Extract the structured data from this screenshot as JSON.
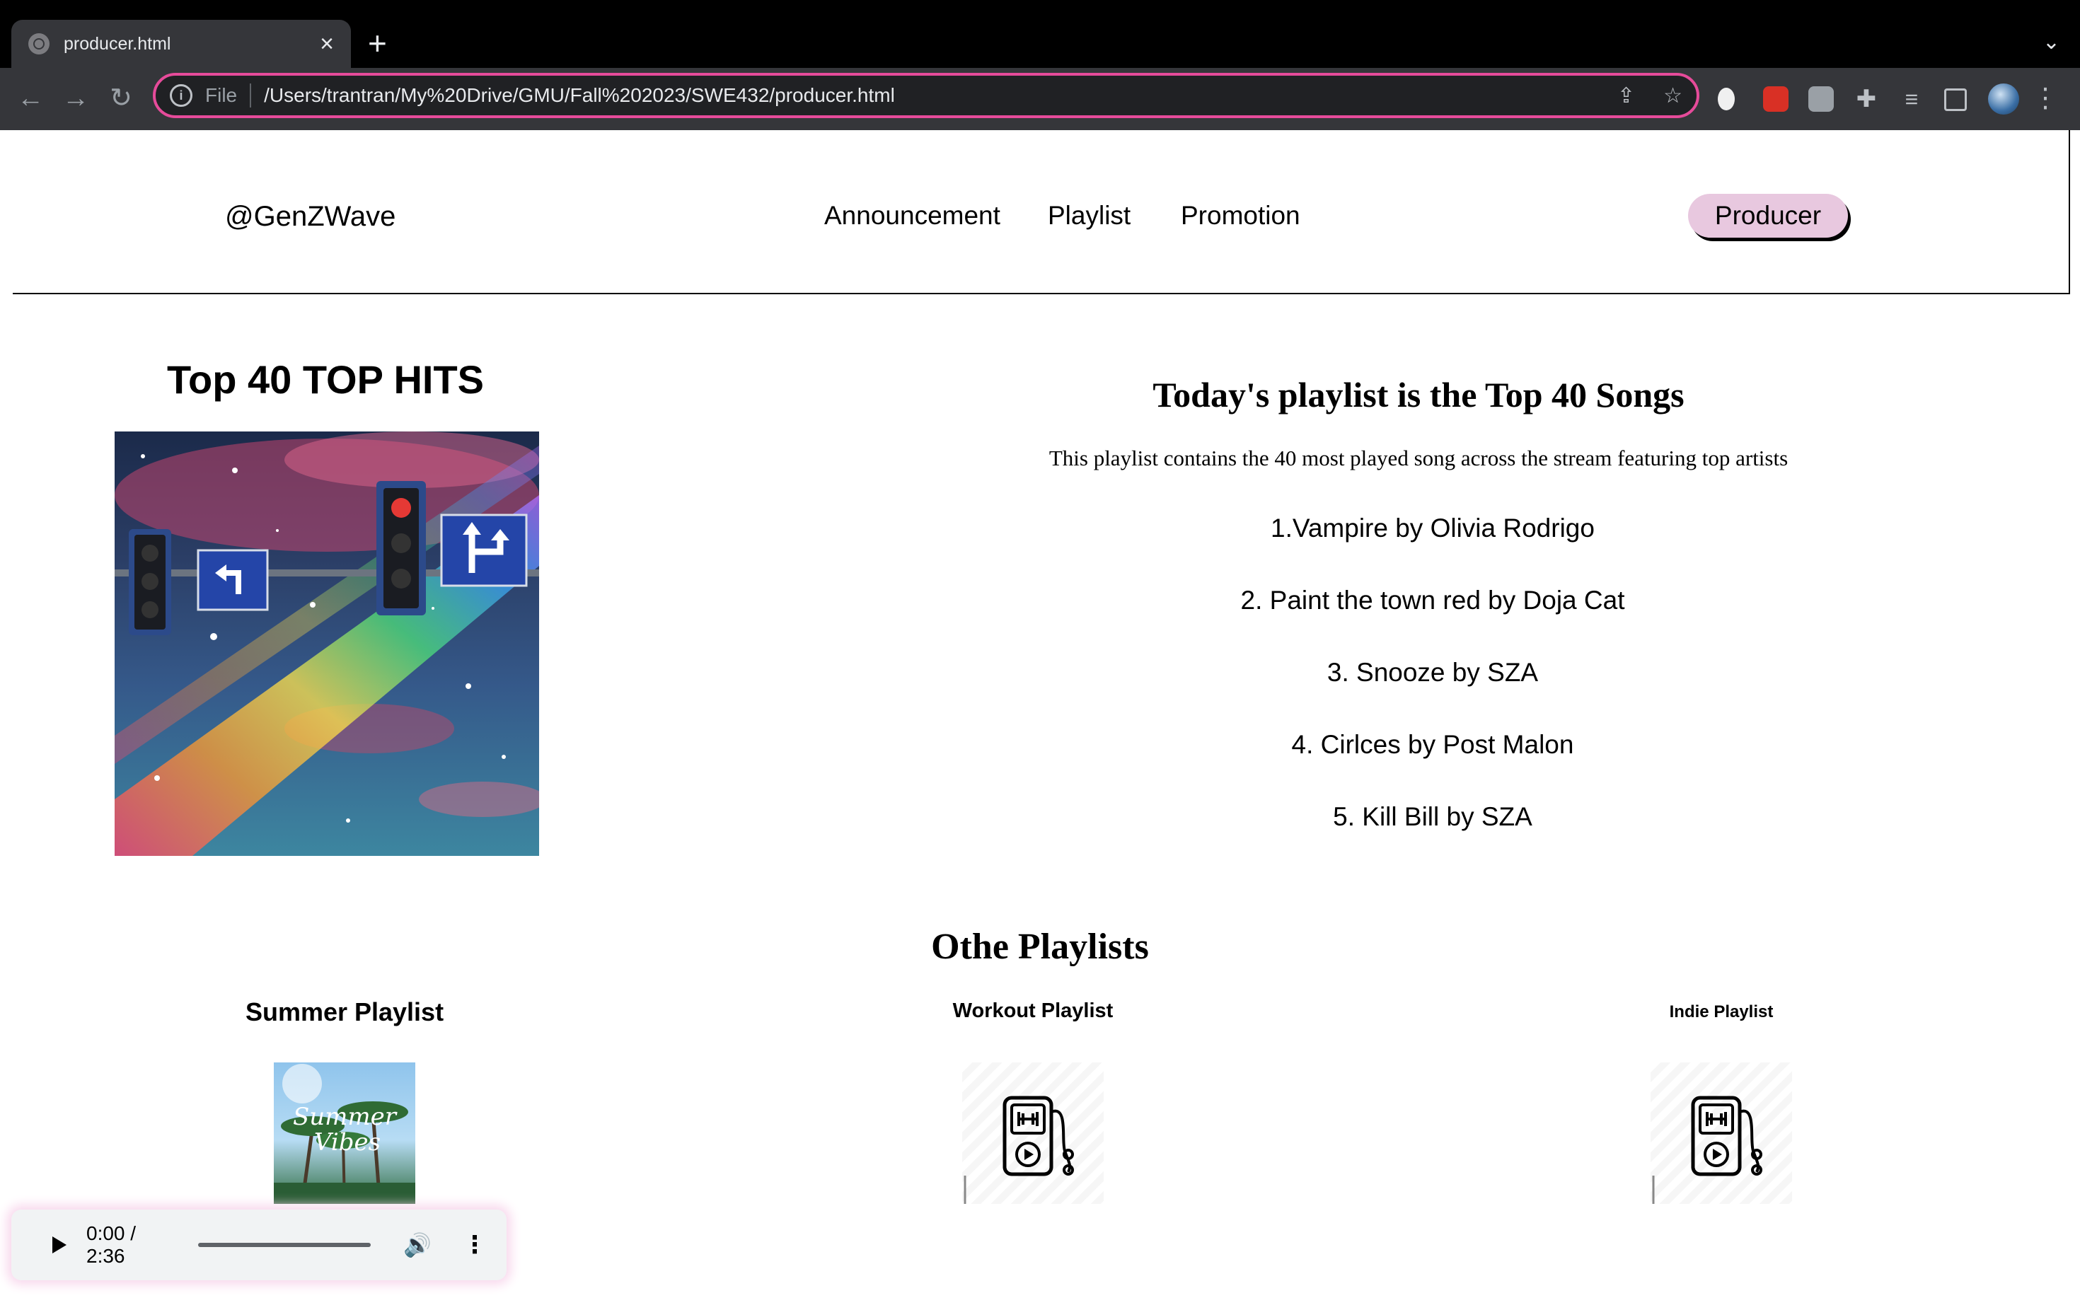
{
  "browser": {
    "tab_title": "producer.html",
    "new_tab": "+",
    "close": "×",
    "scheme_label": "File",
    "url": "/Users/trantran/My%20Drive/GMU/Fall%202023/SWE432/producer.html"
  },
  "header": {
    "brand": "@GenZWave",
    "nav": [
      "Announcement",
      "Playlist",
      "Promotion"
    ],
    "producer_button": "Producer"
  },
  "hero": {
    "title": "Top 40 TOP HITS",
    "playlist_heading": "Today's playlist is the Top 40 Songs",
    "description": "This playlist contains the 40 most played song across the stream featuring top artists",
    "songs": [
      "1.Vampire by Olivia Rodrigo",
      "2. Paint the town red by Doja Cat",
      "3. Snooze by SZA",
      "4. Cirlces by Post Malon",
      "5. Kill Bill by SZA"
    ]
  },
  "other": {
    "title": "Othe Playlists",
    "playlists": [
      "Summer Playlist",
      "Workout Playlist",
      "Indie Playlist"
    ],
    "summer_cover_text": [
      "Summer",
      "Vibes"
    ]
  },
  "audio": {
    "time": "0:00 / 2:36",
    "progress": 0
  },
  "colors": {
    "accent_border": "#e64b9a",
    "producer_bg": "#e8c8df"
  }
}
